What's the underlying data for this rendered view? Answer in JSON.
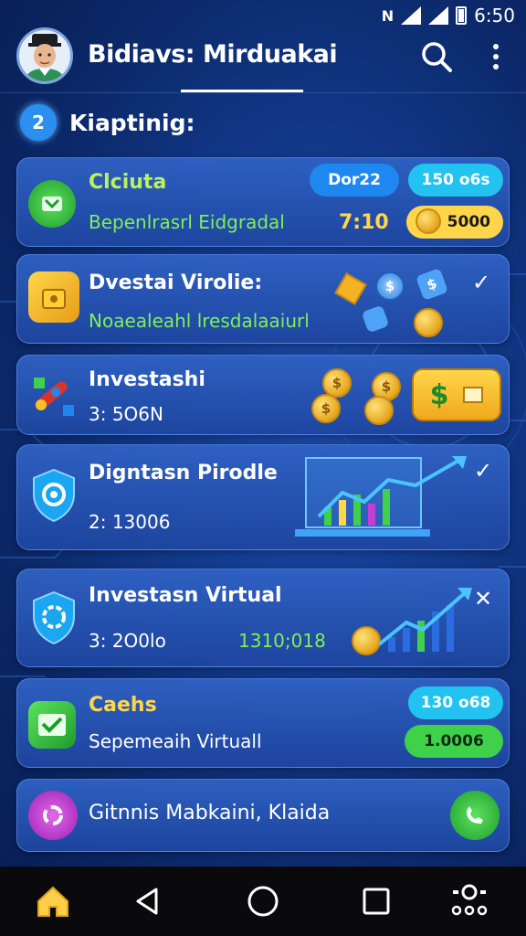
{
  "status_bar": {
    "time": "6:50",
    "nfc": "N"
  },
  "header": {
    "title": "Bidiavs: Mirduakai"
  },
  "section": {
    "icon_glyph": "2",
    "title": "Kiaptinig:"
  },
  "cards": [
    {
      "title": "Clciuta",
      "subtitle": "Bepenlrasrl Eidgradal",
      "value": "7:10",
      "pill_top": "Dor22",
      "pill_right": "150 o6s",
      "pill_amount": "5000"
    },
    {
      "title": "Dvestai Virolie:",
      "subtitle": "Noaealeahl lresdalaaiurl"
    },
    {
      "title": "Investashi",
      "subtitle": "3: 5O6N"
    },
    {
      "title": "Digntasn Pirodle",
      "subtitle": "2: 13006"
    },
    {
      "title": "Investasn Virtual",
      "subtitle": "3: 2O0lo",
      "value": "1310;018"
    },
    {
      "title": "Caehs",
      "subtitle": "Sepemeaih Virtuall",
      "pill_top": "130 o68",
      "pill_amount": "1.0006"
    },
    {
      "title": "Gitnnis Mabkaini, Klaida"
    }
  ],
  "colors": {
    "accent_green": "#3fd14a",
    "accent_yellow": "#ffd64a",
    "accent_cyan": "#22c3f0",
    "accent_blue": "#1e88f0",
    "magenta": "#c43dd6"
  }
}
